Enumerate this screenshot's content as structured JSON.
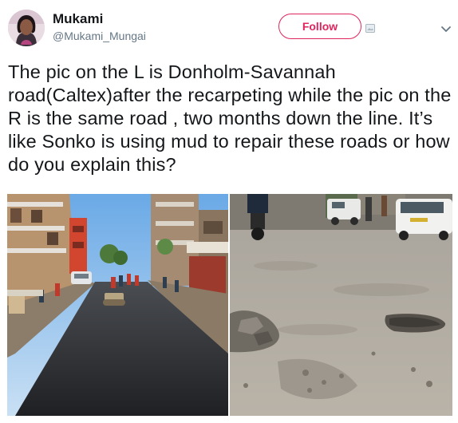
{
  "author": {
    "display_name": "Mukami",
    "handle": "@Mukami_Mungai"
  },
  "actions": {
    "follow_label": "Follow"
  },
  "tweet": {
    "text": "The pic on the L is Donholm-Savannah road(Caltex)after the recarpeting while the pic on the R is the same road , two months down the line. It’s like Sonko is using mud to repair these roads or how do you explain this?"
  },
  "icons": {
    "avatar": "user-avatar",
    "small": "image-icon",
    "menu": "chevron-down-icon"
  },
  "colors": {
    "follow": "#e0245e",
    "text": "#14171a",
    "secondary": "#657786"
  }
}
